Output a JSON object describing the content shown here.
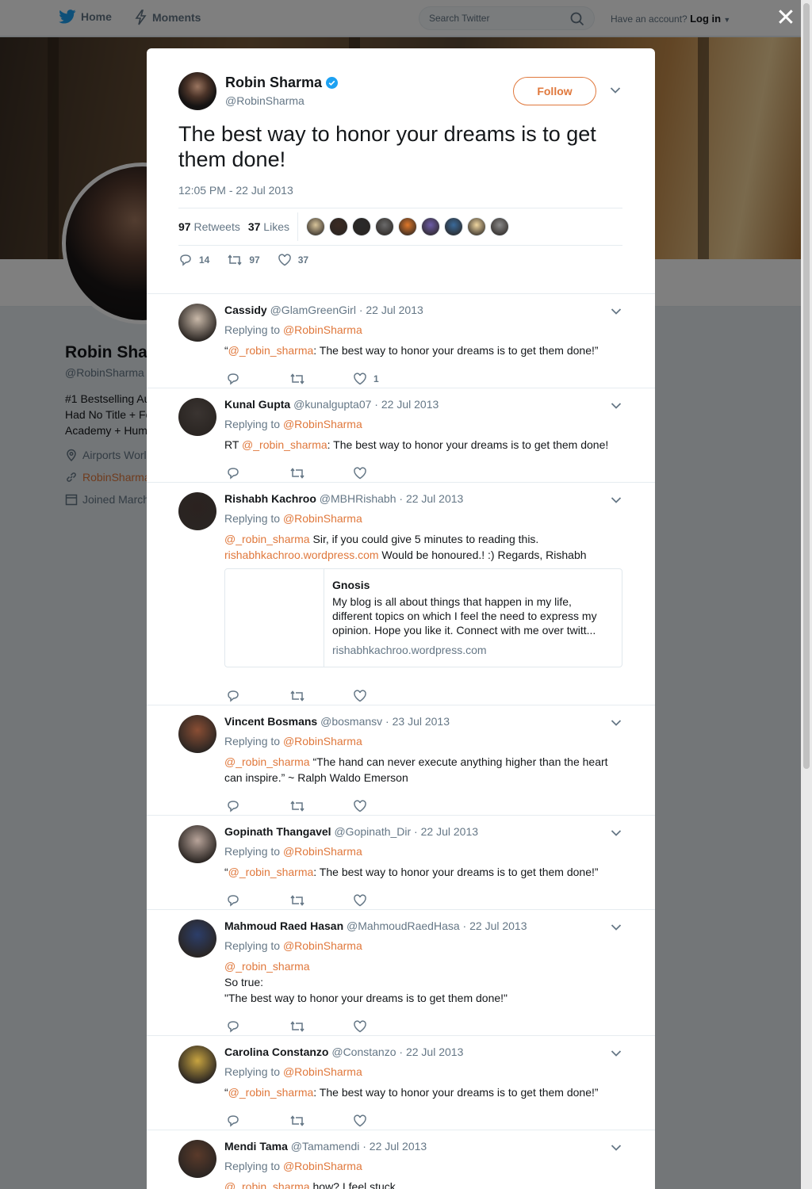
{
  "nav": {
    "home_label": "Home",
    "moments_label": "Moments",
    "search_placeholder": "Search Twitter",
    "have_account": "Have an account?",
    "login_label": "Log in"
  },
  "profile": {
    "name": "Robin Sharma",
    "handle": "@RobinSharma",
    "bio_line1": "#1 Bestselling Au",
    "bio_line2": "Had No Title + Fo",
    "bio_line3": "Academy + Hum",
    "location": "Airports World",
    "website": "RobinSharma",
    "joined": "Joined March"
  },
  "tweet": {
    "author_name": "Robin Sharma",
    "author_handle": "@RobinSharma",
    "follow_label": "Follow",
    "text": "The best way to honor your dreams is to get them done!",
    "timestamp": "12:05 PM - 22 Jul 2013",
    "retweets_count": "97",
    "retweets_label": "Retweets",
    "likes_count": "37",
    "likes_label": "Likes",
    "reply_count": "14",
    "retweet_count": "97",
    "like_count": "37",
    "liker_colors": [
      "#d8c49a",
      "#3b2a22",
      "#2a2a2a",
      "#6a6a6a",
      "#e0782a",
      "#6d5ca8",
      "#3a6a9a",
      "#f0d6a0",
      "#8a8a8a"
    ]
  },
  "replies": [
    {
      "name": "Cassidy",
      "handle": "@GlamGreenGirl",
      "date": "22 Jul 2013",
      "replying_prefix": "Replying to",
      "replying_to": "@RobinSharma",
      "open_quote": "“",
      "mention": "@_robin_sharma",
      "text": ": The best way to honor your dreams is to get them done!”",
      "like_count": "1",
      "avatar_color": "#c9b9a9"
    },
    {
      "name": "Kunal Gupta",
      "badge": "",
      "handle": "@kunalgupta07",
      "date": "22 Jul 2013",
      "replying_prefix": "Replying to",
      "replying_to": "@RobinSharma",
      "prefix": "RT ",
      "mention": "@_robin_sharma",
      "text": ": The best way to honor your dreams is to get them done!",
      "avatar_color": "#3a3431"
    },
    {
      "name": "Rishabh Kachroo",
      "handle": "@MBHRishabh",
      "date": "22 Jul 2013",
      "replying_prefix": "Replying to",
      "replying_to": "@RobinSharma",
      "mention": "@_robin_sharma",
      "text": " Sir, if you could give 5 minutes to reading this.",
      "link": "rishabhkachroo.wordpress.com",
      "text2": " Would be honoured.! :) Regards, Rishabh",
      "card_title": "Gnosis",
      "card_desc": "My blog is all about things that happen in my life, different topics on which I feel the need to express my opinion. Hope you like it. Connect with me over twitt...",
      "card_url": "rishabhkachroo.wordpress.com",
      "avatar_color": "#2b2220"
    },
    {
      "name": "Vincent Bosmans",
      "handle": "@bosmansv",
      "date": "23 Jul 2013",
      "replying_prefix": "Replying to",
      "replying_to": "@RobinSharma",
      "mention": "@_robin_sharma",
      "text": " “The hand can never execute anything higher than the heart can inspire.”  ~ Ralph Waldo Emerson",
      "avatar_color": "#8a4e34"
    },
    {
      "name": "Gopinath Thangavel",
      "handle": "@Gopinath_Dir",
      "date": "22 Jul 2013",
      "replying_prefix": "Replying to",
      "replying_to": "@RobinSharma",
      "open_quote": "“",
      "mention": "@_robin_sharma",
      "text": ": The best way to honor your dreams is to get them done!”",
      "avatar_color": "#b8a49a"
    },
    {
      "name": "Mahmoud Raed Hasan",
      "handle": "@MahmoudRaedHasa",
      "date": "22 Jul 2013",
      "replying_prefix": "Replying to",
      "replying_to": "@RobinSharma",
      "mention": "@_robin_sharma",
      "line2": "So true:",
      "line3": "\"The best way to honor your dreams is to get them done!\"",
      "avatar_color": "#2c3e6a"
    },
    {
      "name": "Carolina Constanzo",
      "handle": "@Constanzo",
      "date": "22 Jul 2013",
      "replying_prefix": "Replying to",
      "replying_to": "@RobinSharma",
      "open_quote": "“",
      "mention": "@_robin_sharma",
      "text": ": The best way to honor your dreams is to get them done!”",
      "avatar_color": "#c8a440"
    },
    {
      "name": "Mendi Tama",
      "handle": "@Tamamendi",
      "date": "22 Jul 2013",
      "replying_prefix": "Replying to",
      "replying_to": "@RobinSharma",
      "mention": "@_robin_sharma",
      "text": " how? I feel stuck..",
      "avatar_color": "#5a3a2a"
    }
  ],
  "date_separator": " · "
}
